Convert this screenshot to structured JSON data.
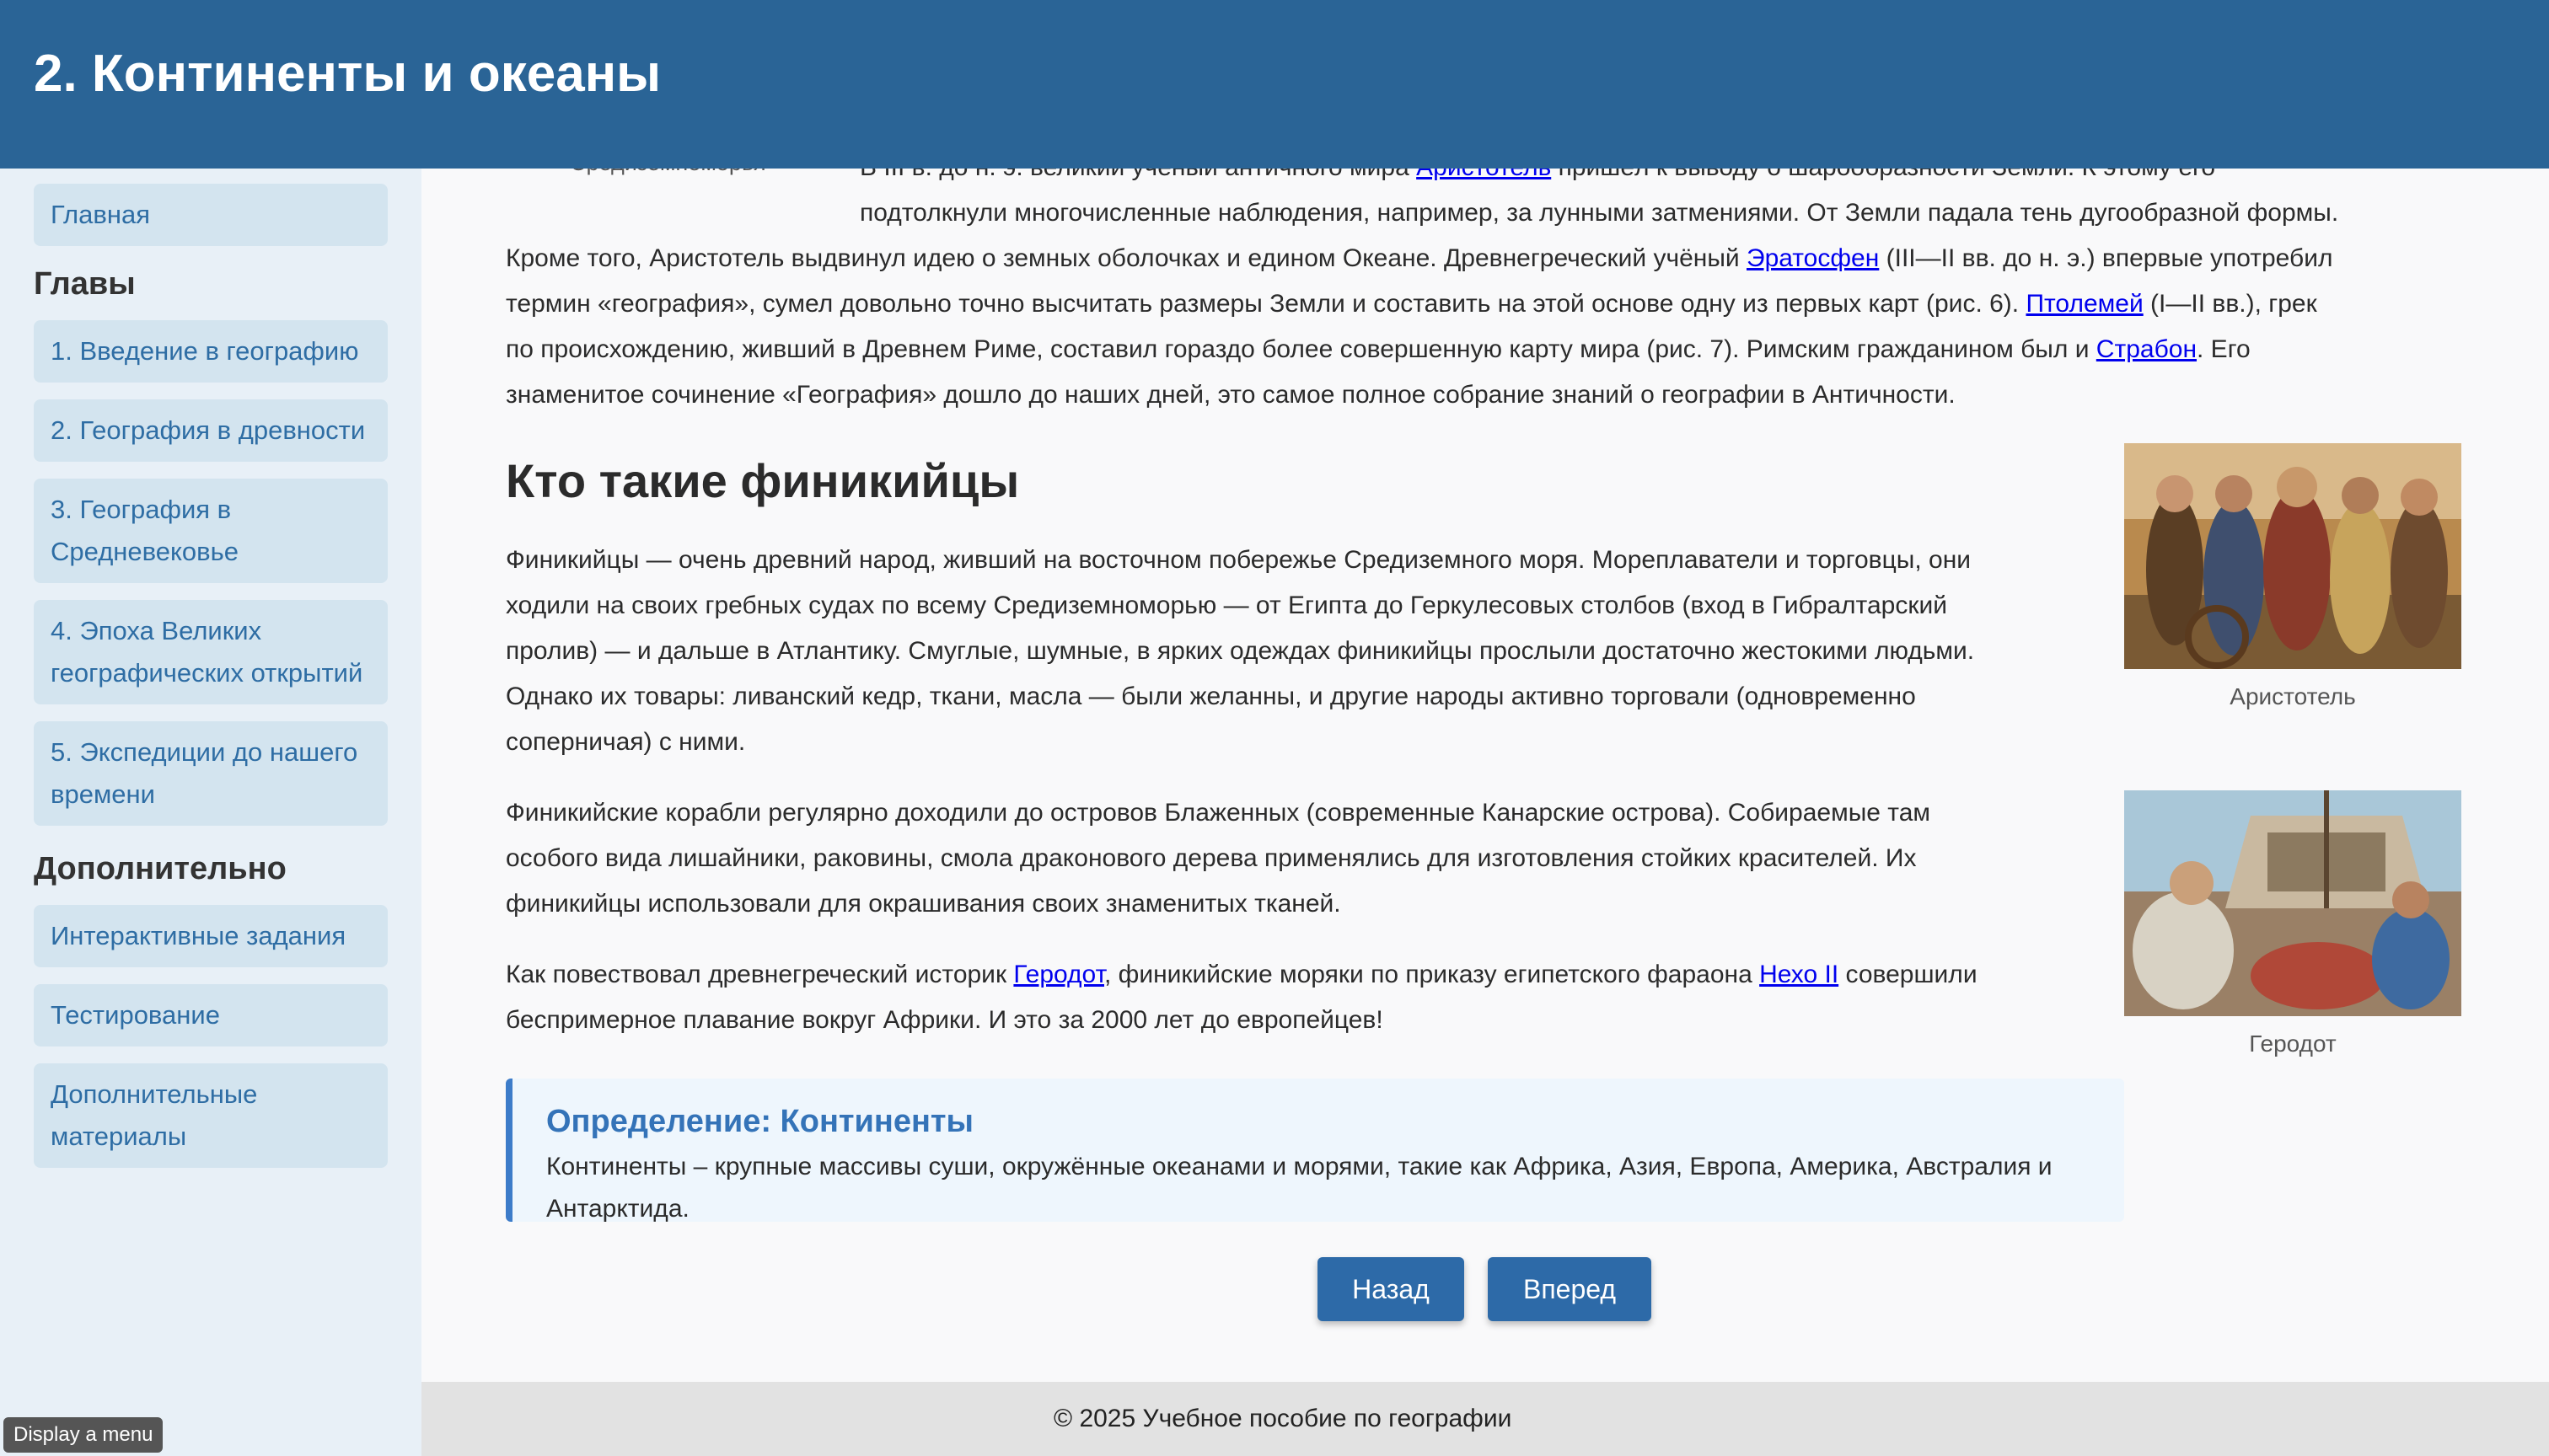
{
  "header": {
    "title": "2. Континенты и океаны"
  },
  "sidebar": {
    "home": "Главная",
    "chapters_heading": "Главы",
    "chapters": [
      "1. Введение в географию",
      "2. География в древности",
      "3. География в Средневековье",
      "4. Эпоха Великих географических открытий",
      "5. Экспедиции до нашего времени"
    ],
    "extra_heading": "Дополнительно",
    "extra": [
      "Интерактивные задания",
      "Тестирование",
      "Дополнительные материалы"
    ]
  },
  "content": {
    "top_caption": "Средиземноморья",
    "intro": {
      "line1_a": "В III в. до н. э. великий учёный античного мира ",
      "link_aristotle": "Аристотель",
      "line1_b": " пришёл к выводу о шарообразности Земли. К этому его",
      "line2": "подтолкнули многочисленные наблюдения, например, за лунными затмениями. От Земли падала тень дугообразной формы.",
      "line3_a": "Кроме того, Аристотель выдвинул идею о земных оболочках и едином Океане. Древнегреческий учёный ",
      "link_eratosthenes": "Эратосфен",
      "line3_b": " (III—II вв. до н. э.) впервые употребил",
      "line4_a": "термин «география», сумел довольно точно высчитать размеры Земли и составить на этой основе одну из первых карт (рис. 6). ",
      "link_ptolemy": "Птолемей",
      "line4_b": " (I—II вв.), грек",
      "line5_a": "по происхождению, живший в Древнем Риме, составил гораздо более совершенную карту мира (рис. 7). Римским гражданином был и ",
      "link_strabo": "Страбон",
      "line5_b": ". Его",
      "line6": "знаменитое сочинение «География» дошло до наших дней, это самое полное собрание знаний о географии в Античности."
    },
    "heading": "Кто такие финикийцы",
    "p1": [
      "Финикийцы — очень древний народ, живший на восточном побережье Средиземного моря. Мореплаватели и торговцы, они",
      "ходили на своих гребных судах по всему Средиземноморью — от Египта до Геркулесовых столбов (вход в Гибралтарский",
      "пролив) — и дальше в Атлантику. Смуглые, шумные, в ярких одеждах финикийцы прослыли достаточно жестокими людьми.",
      "Однако их товары: ливанский кедр, ткани, масла — были желанны, и другие народы активно торговали (одновременно",
      "соперничая) с ними."
    ],
    "p2": [
      "Финикийские корабли регулярно доходили до островов Блаженных (современные Канарские острова). Собираемые там",
      "особого вида лишайники, раковины, смола драконового дерева применялись для изготовления стойких красителей. Их",
      "финикийцы использовали для окрашивания своих знаменитых тканей."
    ],
    "p3": {
      "a": "Как повествовал древнегреческий историк ",
      "link_herodotus": "Геродот",
      "b": ", финикийские моряки по приказу египетского фараона ",
      "link_necho": "Нехо II",
      "c": " совершили",
      "line2": "беспримерное плавание вокруг Африки. И это за 2000 лет до европейцев!"
    },
    "figure1_caption": "Аристотель",
    "figure2_caption": "Геродот",
    "definition": {
      "title": "Определение: Континенты",
      "text": "Континенты – крупные массивы суши, окружённые океанами и морями, такие как Африка, Азия, Европа, Америка, Австралия и Антарктида."
    },
    "buttons": {
      "back": "Назад",
      "forward": "Вперед"
    }
  },
  "footer": {
    "text": "© 2025 Учебное пособие по географии"
  },
  "tooltip": {
    "text": "Display a menu"
  },
  "colors": {
    "header": "#2a6496",
    "sidebar_bg": "#e8f0f7",
    "nav_item_bg": "#d3e4ef",
    "link": "#0000ee",
    "button": "#2d6aa8",
    "definition_accent": "#3d7cc9"
  }
}
